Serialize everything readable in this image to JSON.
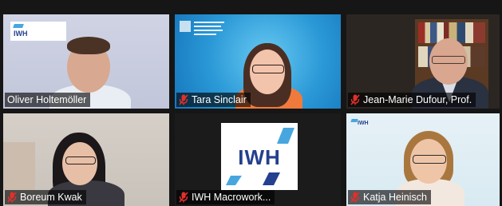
{
  "participants": [
    {
      "name": "Oliver Holtemöller",
      "muted": false,
      "logo": "IWH"
    },
    {
      "name": "Tara Sinclair",
      "muted": true
    },
    {
      "name": "Jean-Marie Dufour, Prof.",
      "muted": true
    },
    {
      "name": "Boreum Kwak",
      "muted": true
    },
    {
      "name": "IWH Macrowork...",
      "muted": true,
      "logo": "IWH"
    },
    {
      "name": "Katja Heinisch",
      "muted": true,
      "logo": "IWH"
    }
  ],
  "colors": {
    "muted_icon": "#e0302b",
    "name_text": "#ffffff",
    "iwh_blue": "#24408e",
    "iwh_light": "#48a6df"
  },
  "icons": [
    "muted-mic-icon"
  ]
}
